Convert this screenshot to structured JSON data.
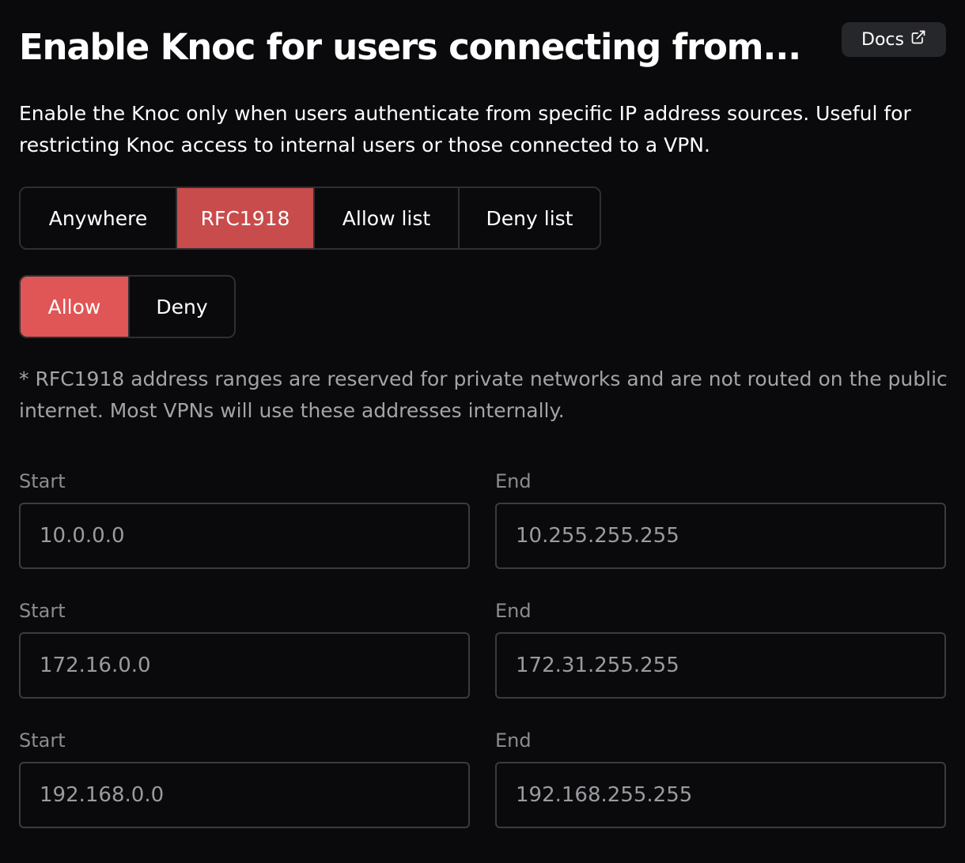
{
  "header": {
    "title": "Enable Knoc for users connecting from...",
    "docs_label": "Docs"
  },
  "description": "Enable the Knoc only when users authenticate from specific IP address sources. Useful for restricting Knoc access to internal users or those connected to a VPN.",
  "source_tabs": [
    {
      "label": "Anywhere",
      "active": false
    },
    {
      "label": "RFC1918",
      "active": true
    },
    {
      "label": "Allow list",
      "active": false
    },
    {
      "label": "Deny list",
      "active": false
    }
  ],
  "mode_tabs": [
    {
      "label": "Allow",
      "active": true
    },
    {
      "label": "Deny",
      "active": false
    }
  ],
  "note": "* RFC1918 address ranges are reserved for private networks and are not routed on the public internet. Most VPNs will use these addresses internally.",
  "ranges": [
    {
      "start_label": "Start",
      "start": "10.0.0.0",
      "end_label": "End",
      "end": "10.255.255.255"
    },
    {
      "start_label": "Start",
      "start": "172.16.0.0",
      "end_label": "End",
      "end": "172.31.255.255"
    },
    {
      "start_label": "Start",
      "start": "192.168.0.0",
      "end_label": "End",
      "end": "192.168.255.255"
    }
  ],
  "colors": {
    "background": "#0a0a0c",
    "active_tab": "#c94c4c",
    "active_mode": "#e05555",
    "border": "#2e2f33",
    "muted_text": "#a3a3a8"
  }
}
